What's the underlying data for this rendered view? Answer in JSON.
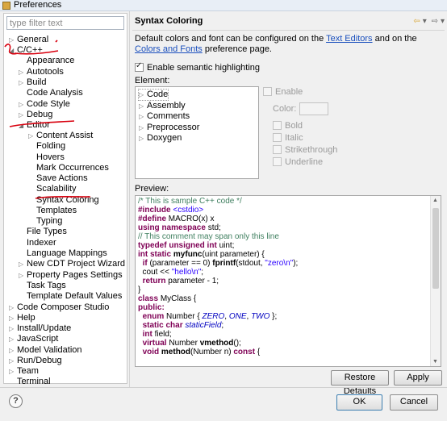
{
  "window": {
    "title": "Preferences"
  },
  "filter": {
    "placeholder": "type filter text"
  },
  "tree": [
    {
      "label": "General",
      "twisty": "▷"
    },
    {
      "label": "C/C++",
      "twisty": "◢"
    },
    {
      "label": "Appearance",
      "twisty": ""
    },
    {
      "label": "Autotools",
      "twisty": "▷"
    },
    {
      "label": "Build",
      "twisty": "▷"
    },
    {
      "label": "Code Analysis",
      "twisty": ""
    },
    {
      "label": "Code Style",
      "twisty": "▷"
    },
    {
      "label": "Debug",
      "twisty": "▷"
    },
    {
      "label": "Editor",
      "twisty": "◢"
    },
    {
      "label": "Content Assist",
      "twisty": "▷"
    },
    {
      "label": "Folding",
      "twisty": ""
    },
    {
      "label": "Hovers",
      "twisty": ""
    },
    {
      "label": "Mark Occurrences",
      "twisty": ""
    },
    {
      "label": "Save Actions",
      "twisty": ""
    },
    {
      "label": "Scalability",
      "twisty": ""
    },
    {
      "label": "Syntax Coloring",
      "twisty": ""
    },
    {
      "label": "Templates",
      "twisty": ""
    },
    {
      "label": "Typing",
      "twisty": ""
    },
    {
      "label": "File Types",
      "twisty": ""
    },
    {
      "label": "Indexer",
      "twisty": ""
    },
    {
      "label": "Language Mappings",
      "twisty": ""
    },
    {
      "label": "New CDT Project Wizard",
      "twisty": "▷"
    },
    {
      "label": "Property Pages Settings",
      "twisty": "▷"
    },
    {
      "label": "Task Tags",
      "twisty": ""
    },
    {
      "label": "Template Default Values",
      "twisty": ""
    },
    {
      "label": "Code Composer Studio",
      "twisty": "▷"
    },
    {
      "label": "Help",
      "twisty": "▷"
    },
    {
      "label": "Install/Update",
      "twisty": "▷"
    },
    {
      "label": "JavaScript",
      "twisty": "▷"
    },
    {
      "label": "Model Validation",
      "twisty": "▷"
    },
    {
      "label": "Run/Debug",
      "twisty": "▷"
    },
    {
      "label": "Team",
      "twisty": "▷"
    },
    {
      "label": "Terminal",
      "twisty": ""
    }
  ],
  "page": {
    "title": "Syntax Coloring",
    "nav": {
      "back": "⇦",
      "back_menu": "▾",
      "forward": "⇨",
      "forward_menu": "▾"
    },
    "desc_before": "Default colors and font can be configured on the ",
    "link_text_editors": "Text Editors",
    "desc_mid": " and on the ",
    "link_colors_fonts": "Colors and Fonts",
    "desc_after": " preference page.",
    "semantic_label": "Enable semantic highlighting",
    "element_label": "Element:",
    "elements": [
      {
        "label": "Code",
        "twisty": "▷"
      },
      {
        "label": "Assembly",
        "twisty": "▷"
      },
      {
        "label": "Comments",
        "twisty": "▷"
      },
      {
        "label": "Preprocessor",
        "twisty": "▷"
      },
      {
        "label": "Doxygen",
        "twisty": "▷"
      }
    ],
    "options": {
      "enable": "Enable",
      "color": "Color:",
      "bold": "Bold",
      "italic": "Italic",
      "strikethrough": "Strikethrough",
      "underline": "Underline"
    },
    "preview_label": "Preview:",
    "code_lines": [
      [
        {
          "t": "/* This is sample C++ code */",
          "c": "cm"
        }
      ],
      [
        {
          "t": "#include ",
          "c": "pp"
        },
        {
          "t": "<cstdio>",
          "c": "st"
        }
      ],
      [
        {
          "t": "#define ",
          "c": "pp"
        },
        {
          "t": "MACRO(x) x",
          "c": ""
        }
      ],
      [
        {
          "t": "using namespace ",
          "c": "kw"
        },
        {
          "t": "std;",
          "c": ""
        }
      ],
      [
        {
          "t": "// This comment may span only this line",
          "c": "cm"
        }
      ],
      [
        {
          "t": "typedef unsigned int ",
          "c": "kw"
        },
        {
          "t": "uint;",
          "c": ""
        }
      ],
      [
        {
          "t": "int static ",
          "c": "kw"
        },
        {
          "t": "myfunc",
          "c": "fn"
        },
        {
          "t": "(uint parameter) {",
          "c": ""
        }
      ],
      [
        {
          "t": "  ",
          "c": ""
        },
        {
          "t": "if ",
          "c": "kw"
        },
        {
          "t": "(parameter == 0) ",
          "c": ""
        },
        {
          "t": "fprintf",
          "c": "fn"
        },
        {
          "t": "(stdout, ",
          "c": ""
        },
        {
          "t": "\"zero\\n\"",
          "c": "st"
        },
        {
          "t": ");",
          "c": ""
        }
      ],
      [
        {
          "t": "  cout << ",
          "c": ""
        },
        {
          "t": "\"hello\\n\"",
          "c": "st"
        },
        {
          "t": ";",
          "c": ""
        }
      ],
      [
        {
          "t": "  ",
          "c": ""
        },
        {
          "t": "return ",
          "c": "kw"
        },
        {
          "t": "parameter - 1;",
          "c": ""
        }
      ],
      [
        {
          "t": "}",
          "c": ""
        }
      ],
      [
        {
          "t": "class ",
          "c": "kw"
        },
        {
          "t": "MyClass {",
          "c": ""
        }
      ],
      [
        {
          "t": "public:",
          "c": "kw"
        }
      ],
      [
        {
          "t": "  ",
          "c": ""
        },
        {
          "t": "enum ",
          "c": "kw"
        },
        {
          "t": "Number { ",
          "c": ""
        },
        {
          "t": "ZERO",
          "c": "en"
        },
        {
          "t": ", ",
          "c": ""
        },
        {
          "t": "ONE",
          "c": "en"
        },
        {
          "t": ", ",
          "c": ""
        },
        {
          "t": "TWO",
          "c": "en"
        },
        {
          "t": " };",
          "c": ""
        }
      ],
      [
        {
          "t": "  ",
          "c": ""
        },
        {
          "t": "static char ",
          "c": "kw"
        },
        {
          "t": "staticField",
          "c": "en"
        },
        {
          "t": ";",
          "c": ""
        }
      ],
      [
        {
          "t": "  ",
          "c": ""
        },
        {
          "t": "int ",
          "c": "kw"
        },
        {
          "t": "field;",
          "c": ""
        }
      ],
      [
        {
          "t": "  ",
          "c": ""
        },
        {
          "t": "virtual ",
          "c": "kw"
        },
        {
          "t": "Number ",
          "c": ""
        },
        {
          "t": "vmethod",
          "c": "fn"
        },
        {
          "t": "();",
          "c": ""
        }
      ],
      [
        {
          "t": "  ",
          "c": ""
        },
        {
          "t": "void ",
          "c": "kw"
        },
        {
          "t": "method",
          "c": "fn"
        },
        {
          "t": "(Number n) ",
          "c": ""
        },
        {
          "t": "const",
          "c": "kw"
        },
        {
          "t": " {",
          "c": ""
        }
      ]
    ],
    "restore_defaults": "Restore Defaults",
    "apply": "Apply"
  },
  "footer": {
    "help_icon": "?",
    "ok": "OK",
    "cancel": "Cancel"
  },
  "colors": {
    "link": "#1a4fbd",
    "keyword": "#7f0055",
    "comment": "#3f7f5f",
    "string": "#2a00ff",
    "annotation": "#d8000e"
  }
}
